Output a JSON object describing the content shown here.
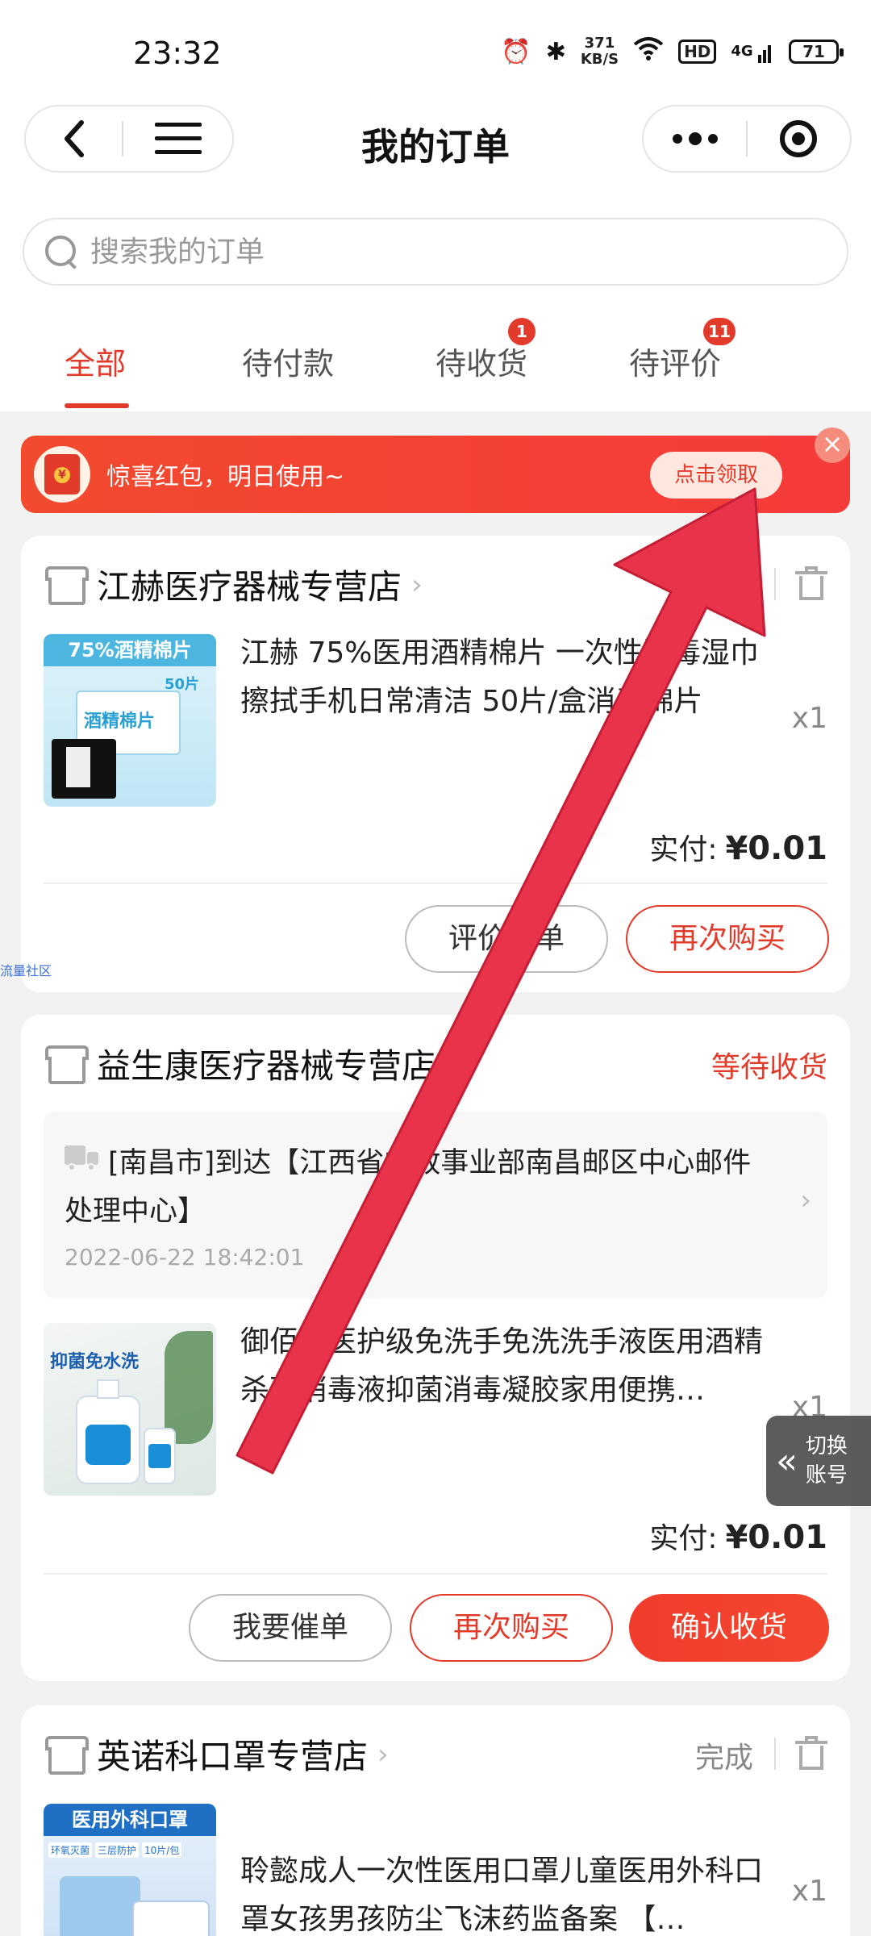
{
  "status_bar": {
    "time": "23:32",
    "speed_value": "371",
    "speed_unit": "KB/S",
    "hd": "HD",
    "network": "4G",
    "battery": "71",
    "icons": [
      "alarm-icon",
      "bluetooth-icon",
      "wifi-icon",
      "signal-icon"
    ]
  },
  "nav": {
    "title": "我的订单",
    "back_icon": "back-arrow-icon",
    "menu_icon": "hamburger-menu-icon",
    "more_icon": "more-dots-icon",
    "close_icon": "target-close-icon"
  },
  "search": {
    "placeholder": "搜索我的订单"
  },
  "tabs": [
    {
      "label": "全部",
      "active": true
    },
    {
      "label": "待付款"
    },
    {
      "label": "待收货",
      "badge": "1"
    },
    {
      "label": "待评价",
      "badge": "11"
    }
  ],
  "promo": {
    "text": "惊喜红包，明日使用~",
    "button": "点击领取",
    "close": "×",
    "coin": "¥"
  },
  "orders": [
    {
      "shop": "江赫医疗器械专营店",
      "product_title": "江赫 75%医用酒精棉片 一次性消毒湿巾擦拭手机日常清洁 50片/盒消毒棉片",
      "qty": "x1",
      "paid_label": "实付:",
      "paid_amount": "¥0.01",
      "img_text_top": "75%酒精棉片",
      "img_text_mid": "酒精棉片",
      "img_text_side": "50片",
      "buttons": [
        "评价晒单",
        "再次购买"
      ]
    },
    {
      "shop": "益生康医疗器械专营店",
      "status": "等待收货",
      "logistics_text": "[南昌市]到达【江西省邮政事业部南昌邮区中心邮件处理中心】",
      "logistics_time": "2022-06-22 18:42:01",
      "product_title": "御佰芙医护级免洗手免洗洗手液医用酒精杀菌消毒液抑菌消毒凝胶家用便携…",
      "qty": "x1",
      "paid_label": "实付:",
      "paid_amount": "¥0.01",
      "img_text_top": "抑菌免水洗",
      "buttons": [
        "我要催单",
        "再次购买",
        "确认收货"
      ]
    },
    {
      "shop": "英诺科口罩专营店",
      "status": "完成",
      "product_title": "聆懿成人一次性医用口罩儿童医用外科口罩女孩男孩防尘飞沫药监备案 【…",
      "qty": "x1",
      "img_text_top": "医用外科口罩",
      "img_tags": [
        "环氧灭菌",
        "三层防护",
        "10片/包"
      ]
    }
  ],
  "side_tag": "流量社区",
  "switch_account": {
    "line1": "切换",
    "line2": "账号",
    "chevron": "«"
  },
  "colors": {
    "accent": "#e23a2b",
    "arrow": "#e8334a"
  }
}
